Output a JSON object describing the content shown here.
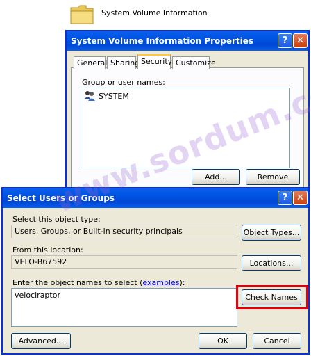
{
  "folder": {
    "name": "System Volume Information",
    "icon": "folder-icon"
  },
  "properties_dialog": {
    "title": "System Volume Information Properties",
    "help_label": "?",
    "close_label": "✕",
    "tabs": [
      {
        "label": "General"
      },
      {
        "label": "Sharing"
      },
      {
        "label": "Security",
        "active": true
      },
      {
        "label": "Customize"
      }
    ],
    "group_label": "Group or user names:",
    "users": [
      {
        "name": "SYSTEM",
        "icon": "users-icon"
      }
    ],
    "add_label": "Add...",
    "remove_label": "Remove"
  },
  "select_dialog": {
    "title": "Select Users or Groups",
    "help_label": "?",
    "close_label": "✕",
    "object_type_label": "Select this object type:",
    "object_type_value": "Users, Groups, or Built-in security principals",
    "object_types_button": "Object Types...",
    "location_label": "From this location:",
    "location_value": "VELO-B67592",
    "locations_button": "Locations...",
    "names_label_prefix": "Enter the object names to select (",
    "names_label_link": "examples",
    "names_label_suffix": "):",
    "names_value": "velociraptor",
    "check_names_button": "Check Names",
    "advanced_button": "Advanced...",
    "ok_button": "OK",
    "cancel_button": "Cancel"
  },
  "watermark": {
    "text": "www.sordum.com"
  },
  "colors": {
    "titlebar_blue": "#0054e3",
    "dialog_face": "#ece9d8",
    "highlight_red": "#e0000f",
    "link_blue": "#0000ee"
  }
}
